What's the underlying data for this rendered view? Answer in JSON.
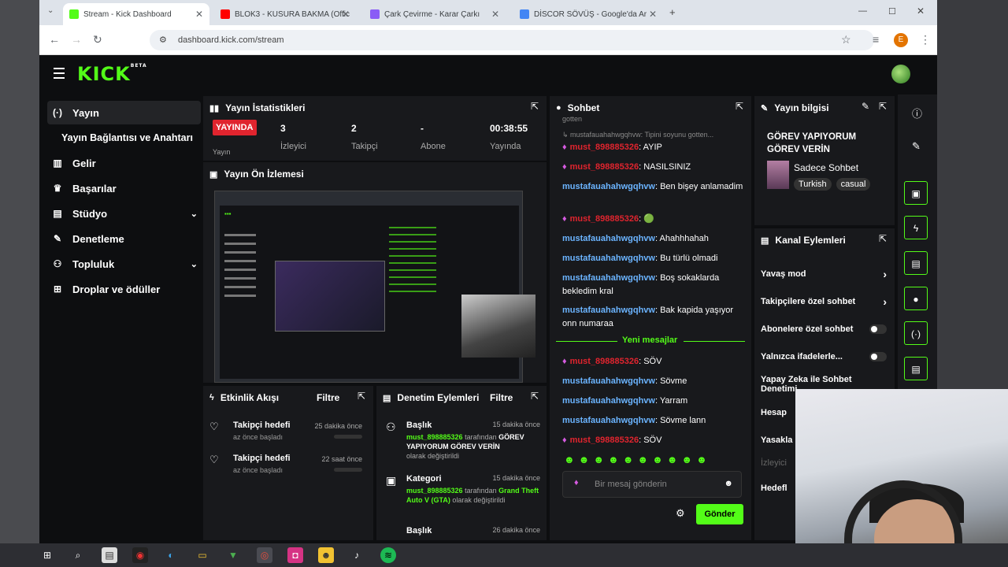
{
  "browser": {
    "tabs": [
      {
        "title": "Stream - Kick Dashboard",
        "active": true,
        "color": "#53fc18"
      },
      {
        "title": "BLOK3 - KUSURA BAKMA (Offic",
        "active": false,
        "color": "#ff0000"
      },
      {
        "title": "Çark Çevirme - Karar Çarkı",
        "active": false,
        "color": "#8a5cf6"
      },
      {
        "title": "DİSCOR SÖVÜŞ - Google'da Ar",
        "active": false,
        "color": "#4285f4"
      }
    ],
    "url": "dashboard.kick.com/stream",
    "profile_initial": "E"
  },
  "app": {
    "logo": "KICK",
    "logo_sup": "BETA"
  },
  "sidebar": {
    "items": [
      {
        "label": "Yayın",
        "icon": "broadcast-icon",
        "glyph": "(·)"
      },
      {
        "label": "Yayın Bağlantısı ve Anahtarı",
        "icon": "",
        "glyph": ""
      },
      {
        "label": "Gelir",
        "icon": "chart-icon",
        "glyph": "▥"
      },
      {
        "label": "Başarılar",
        "icon": "trophy-icon",
        "glyph": "🏆"
      },
      {
        "label": "Stüdyo",
        "icon": "studio-icon",
        "glyph": "▤"
      },
      {
        "label": "Denetleme",
        "icon": "wrench-icon",
        "glyph": "🔧"
      },
      {
        "label": "Topluluk",
        "icon": "users-icon",
        "glyph": "👥"
      },
      {
        "label": "Droplar ve ödüller",
        "icon": "gift-icon",
        "glyph": "⊞"
      }
    ]
  },
  "stats": {
    "title": "Yayın İstatistikleri",
    "live": "YAYINDA",
    "items": [
      {
        "value": "3",
        "label": "İzleyici"
      },
      {
        "value": "2",
        "label": "Takipçi"
      },
      {
        "value": "-",
        "label": "Abone"
      },
      {
        "value": "00:38:55",
        "label": "Yayında"
      }
    ],
    "cut_label": "Yayın"
  },
  "preview": {
    "title": "Yayın Ön İzlemesi"
  },
  "activity": {
    "title": "Etkinlik Akışı",
    "filter": "Filtre",
    "items": [
      {
        "title": "Takipçi hedefi",
        "sub": "az önce başladı",
        "time": "25 dakika önce"
      },
      {
        "title": "Takipçi hedefi",
        "sub": "az önce başladı",
        "time": "22 saat önce"
      }
    ]
  },
  "moderation": {
    "title": "Denetim Eylemleri",
    "filter": "Filtre",
    "items": [
      {
        "type": "Başlık",
        "time": "15 dakika önce",
        "user": "must_898885326",
        "mid": " tarafından ",
        "value": "GÖREV YAPIYORUM GÖREV VERİN",
        "tail": "olarak değiştirildi"
      },
      {
        "type": "Kategori",
        "time": "15 dakika önce",
        "user": "must_898885326",
        "mid": " tarafından ",
        "value": "Grand Theft Auto V (GTA)",
        "tail": " olarak değiştirildi"
      },
      {
        "type": "Başlık",
        "time": "26 dakika önce"
      }
    ]
  },
  "chat": {
    "title": "Sohbet",
    "top_cut": "gotten",
    "reply": "mustafauahahwgqhvw: Tipini soyunu gotten...",
    "messages": [
      {
        "user": "must_898885326",
        "text": "AYIP",
        "kind": "red"
      },
      {
        "user": "must_898885326",
        "text": "NASILSINIZ",
        "kind": "red"
      },
      {
        "user": "mustafauahahwgqhvw",
        "text": "Ben bişey anlamadim",
        "kind": "blue"
      },
      {
        "user": "must_898885326",
        "text": "🟢",
        "kind": "red"
      },
      {
        "user": "mustafauahahwgqhvw",
        "text": "Ahahhhahah",
        "kind": "blue"
      },
      {
        "user": "mustafauahahwgqhvw",
        "text": "Bu türlü olmadi",
        "kind": "blue"
      },
      {
        "user": "mustafauahahwgqhvw",
        "text": "Boş sokaklarda bekledim kral",
        "kind": "blue"
      },
      {
        "user": "mustafauahahwgqhvw",
        "text": "Bak kapida yaşıyor onn numaraa",
        "kind": "blue"
      }
    ],
    "new_label": "Yeni mesajlar",
    "new_messages": [
      {
        "user": "must_898885326",
        "text": "SÖV",
        "kind": "red"
      },
      {
        "user": "mustafauahahwgqhvw",
        "text": "Sövme",
        "kind": "blue"
      },
      {
        "user": "mustafauahahwgqhvw",
        "text": "Yarram",
        "kind": "blue"
      },
      {
        "user": "mustafauahahwgqhvw",
        "text": "Sövme lann",
        "kind": "blue"
      },
      {
        "user": "must_898885326",
        "text": "SÖV",
        "kind": "red"
      }
    ],
    "emotes": "☻☻☻☻☻☻☻☻☻☻",
    "placeholder": "Bir mesaj gönderin",
    "send": "Gönder"
  },
  "info": {
    "title": "Yayın bilgisi",
    "stream_title": "GÖREV YAPIYORUM GÖREV VERİN",
    "category": "Sadece Sohbet",
    "tags": [
      "Turkish",
      "casual"
    ]
  },
  "actions": {
    "title": "Kanal Eylemleri",
    "items": [
      {
        "label": "Yavaş mod",
        "control": "chevron"
      },
      {
        "label": "Takipçilere özel sohbet",
        "control": "chevron"
      },
      {
        "label": "Abonelere özel sohbet",
        "control": "toggle"
      },
      {
        "label": "Yalnızca ifadelerle...",
        "control": "toggle"
      },
      {
        "label": "Yapay Zeka ile Sohbet Denetimi",
        "control": "link"
      },
      {
        "label": "Hesap",
        "control": ""
      },
      {
        "label": "Yasakla",
        "control": ""
      },
      {
        "label": "İzleyici",
        "control": ""
      },
      {
        "label": "Hedefl",
        "control": ""
      }
    ]
  },
  "colors": {
    "accent": "#53fc18",
    "live": "#e0242e",
    "user_blue": "#6bb4ff"
  }
}
